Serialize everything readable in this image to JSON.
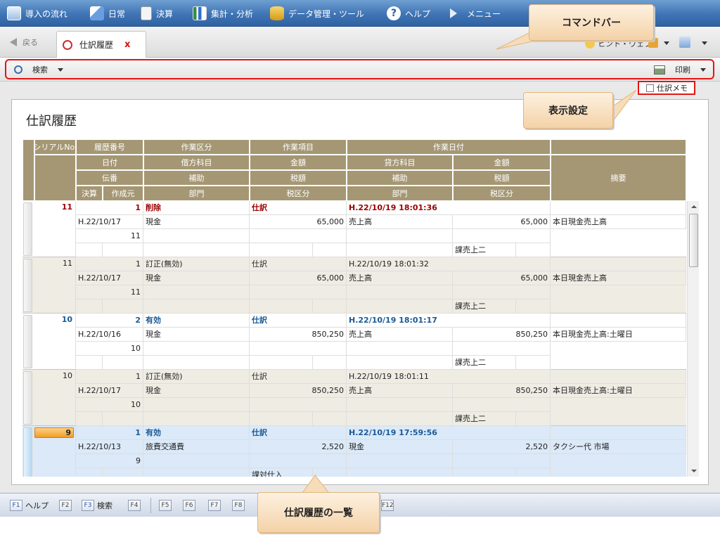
{
  "menubar": {
    "items": [
      {
        "label": "導入の流れ",
        "icon": "intro-flow-icon"
      },
      {
        "label": "日常",
        "icon": "daily-pen-icon"
      },
      {
        "label": "決算",
        "icon": "settlement-doc-icon"
      },
      {
        "label": "集計・分析",
        "icon": "chart-icon"
      },
      {
        "label": "データ管理・ツール",
        "icon": "database-tool-icon"
      },
      {
        "label": "ヘルプ",
        "icon": "help-icon"
      },
      {
        "label": "メニュー",
        "icon": "menu-play-icon"
      }
    ]
  },
  "tabrow": {
    "back_label": "戻る",
    "tab_title": "仕訳履歴",
    "right_label": "ヒント・ウェブ"
  },
  "cmdbar": {
    "search_label": "検索",
    "print_label": "印刷"
  },
  "memo": {
    "label": "仕訳メモ"
  },
  "page": {
    "title": "仕訳履歴"
  },
  "grid_header": {
    "row1": [
      "シリアルNo.",
      "履歴番号",
      "作業区分",
      "作業項目",
      "作業日付"
    ],
    "row2": [
      "日付",
      "借方科目",
      "金額",
      "貸方科目",
      "金額"
    ],
    "row3": [
      "伝番",
      "補助",
      "税額",
      "補助",
      "税額",
      "摘要"
    ],
    "row4": [
      "決算",
      "作成元",
      "部門",
      "税区分",
      "部門",
      "税区分"
    ]
  },
  "records": [
    {
      "serial": "11",
      "hist": "1",
      "kubun": "削除",
      "item": "仕訳",
      "datetime": "H.22/10/19 18:01:36",
      "date": "H.22/10/17",
      "debit": "現金",
      "amount_d": "65,000",
      "credit": "売上高",
      "amount_c": "65,000",
      "memo": "本日現金売上高",
      "denban": "11",
      "tax_c": "課売上二",
      "style": "deleted"
    },
    {
      "serial": "11",
      "hist": "1",
      "kubun": "訂正(無効)",
      "item": "仕訳",
      "datetime": "H.22/10/19 18:01:32",
      "date": "H.22/10/17",
      "debit": "現金",
      "amount_d": "65,000",
      "credit": "売上高",
      "amount_c": "65,000",
      "memo": "本日現金売上高",
      "denban": "11",
      "tax_c": "課売上二",
      "style": "invalid"
    },
    {
      "serial": "10",
      "hist": "2",
      "kubun": "有効",
      "item": "仕訳",
      "datetime": "H.22/10/19 18:01:17",
      "date": "H.22/10/16",
      "debit": "現金",
      "amount_d": "850,250",
      "credit": "売上高",
      "amount_c": "850,250",
      "memo": "本日現金売上高:土曜日",
      "denban": "10",
      "tax_c": "課売上二",
      "style": "valid"
    },
    {
      "serial": "10",
      "hist": "1",
      "kubun": "訂正(無効)",
      "item": "仕訳",
      "datetime": "H.22/10/19 18:01:11",
      "date": "H.22/10/17",
      "debit": "現金",
      "amount_d": "850,250",
      "credit": "売上高",
      "amount_c": "850,250",
      "memo": "本日現金売上高:土曜日",
      "denban": "10",
      "tax_c": "課売上二",
      "style": "invalid"
    },
    {
      "serial": "9",
      "hist": "1",
      "kubun": "有効",
      "item": "仕訳",
      "datetime": "H.22/10/19 17:59:56",
      "date": "H.22/10/13",
      "debit": "旅費交通費",
      "amount_d": "2,520",
      "credit": "現金",
      "amount_c": "2,520",
      "memo": "タクシー代 市場",
      "denban": "9",
      "tax_d": "課対仕入",
      "tax_c": "",
      "style": "selected"
    }
  ],
  "callouts": {
    "command_bar": "コマンドバー",
    "display_settings": "表示設定",
    "history_list": "仕訳履歴の一覧"
  },
  "fkeys": [
    {
      "key": "F1",
      "label": "ヘルプ"
    },
    {
      "key": "F2",
      "label": ""
    },
    {
      "key": "F3",
      "label": "検索"
    },
    {
      "key": "F4",
      "label": ""
    },
    {
      "key": "F5",
      "label": ""
    },
    {
      "key": "F6",
      "label": ""
    },
    {
      "key": "F7",
      "label": ""
    },
    {
      "key": "F8",
      "label": ""
    },
    {
      "key": "F12",
      "label": ""
    }
  ],
  "colors": {
    "header_bg": "#a59774",
    "deleted_text": "#9b0000",
    "valid_text": "#1a5a96",
    "invalid_row_bg": "#efece4",
    "selected_row_bg": "#dbe9f8",
    "callout_border": "#e51414"
  }
}
